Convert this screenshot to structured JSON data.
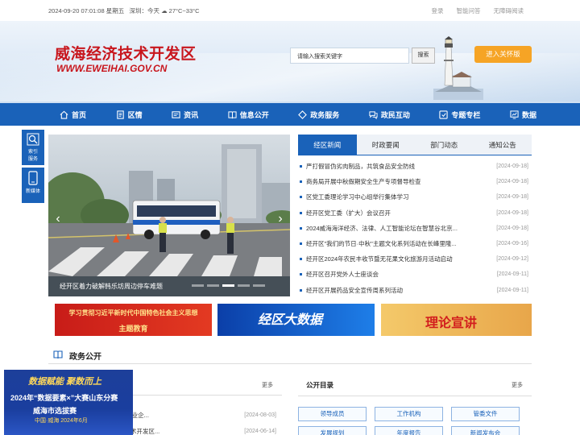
{
  "topbar": {
    "datetime": "2024-09-20 07:01:08 星期五",
    "weather": "深圳：今天 ☁ 27°C~33°C",
    "links": [
      "登录",
      "智能问答",
      "无障碍阅读"
    ]
  },
  "header": {
    "title_cn": "威海经济技术开发区",
    "title_en": "WWW.EWEIHAI.GOV.CN",
    "search_placeholder": "请输入搜索关键字",
    "search_button": "搜索",
    "care_button": "进入关怀版"
  },
  "nav": {
    "items": [
      {
        "label": "首页",
        "icon": "home-icon"
      },
      {
        "label": "区情",
        "icon": "document-icon"
      },
      {
        "label": "资讯",
        "icon": "news-icon"
      },
      {
        "label": "信息公开",
        "icon": "book-icon"
      },
      {
        "label": "政务服务",
        "icon": "diamond-icon"
      },
      {
        "label": "政民互动",
        "icon": "interaction-icon"
      },
      {
        "label": "专题专栏",
        "icon": "topic-icon"
      },
      {
        "label": "数据",
        "icon": "chart-icon"
      }
    ]
  },
  "float_sidebar": {
    "items": [
      {
        "label1": "索引",
        "label2": "服务"
      },
      {
        "label1": "新媒体",
        "label2": ""
      }
    ]
  },
  "carousel": {
    "caption": "经开区着力破解韩乐坊周边停车难题",
    "slide_count": 5,
    "active_index": 2
  },
  "news": {
    "tabs": [
      "经区新闻",
      "时政要闻",
      "部门动态",
      "通知公告"
    ],
    "active_tab": 0,
    "items": [
      {
        "title": "严打假冒伪劣肉制品，共筑食品安全防线",
        "date": "[2024-09-18]"
      },
      {
        "title": "商务局开展中秋假期安全生产专项督导检查",
        "date": "[2024-09-18]"
      },
      {
        "title": "区党工委理论学习中心组举行集体学习",
        "date": "[2024-09-18]"
      },
      {
        "title": "经开区党工委（扩大）会议召开",
        "date": "[2024-09-18]"
      },
      {
        "title": "2024威海海洋经济、法律、人工智能论坛在智慧谷北京...",
        "date": "[2024-09-18]"
      },
      {
        "title": "经开区\"我们的节日·中秋\"主题文化系列活动在长峰里隆...",
        "date": "[2024-09-16]"
      },
      {
        "title": "经开区2024年农民丰收节暨无花果文化旅游月活动启动",
        "date": "[2024-09-12]"
      },
      {
        "title": "经开区召开党外人士座谈会",
        "date": "[2024-09-11]"
      },
      {
        "title": "经开区开展药品安全宣传周系列活动",
        "date": "[2024-09-11]"
      }
    ]
  },
  "promos": {
    "p1_line1": "学习贯彻习近平新时代中国特色社会主义思想",
    "p1_line2": "主题教育",
    "p2": "经区大数据",
    "p3": "理论宣讲"
  },
  "gov": {
    "title": "政务公开",
    "left_more": "更多",
    "left_items": [
      {
        "title": "于公布2024年度工业企...",
        "date": "[2024-08-03]"
      },
      {
        "title": "于印发威海经济技术开发区...",
        "date": "[2024-06-14]"
      }
    ],
    "right_title": "公开目录",
    "right_more": "更多",
    "directory": [
      "领导成员",
      "工作机构",
      "管委文件",
      "发展规划",
      "年度报告",
      "新闻发布会"
    ]
  },
  "ad": {
    "line1": "数据赋能  聚数而上",
    "line2": "2024年“数据要素×”大赛山东分赛",
    "line3": "威海市选拔赛",
    "line4": "中国·威海  2024年6月"
  },
  "colors": {
    "brand_blue": "#1a62b9",
    "brand_red": "#c8161d",
    "accent_orange": "#f6a425"
  }
}
